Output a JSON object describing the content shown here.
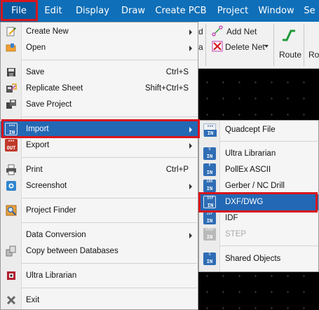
{
  "menubar": {
    "items": [
      "File",
      "Edit",
      "Display",
      "Draw",
      "Create PCB",
      "Project",
      "Window",
      "Se"
    ]
  },
  "toolbar": {
    "add_net": "Add Net",
    "delete_net": "Delete Net",
    "route": "Route",
    "ro": "Ro"
  },
  "file_menu": {
    "create_new": "Create New",
    "open": "Open",
    "save": "Save",
    "save_shortcut": "Ctrl+S",
    "replicate_sheet": "Replicate Sheet",
    "replicate_shortcut": "Shift+Ctrl+S",
    "save_project": "Save Project",
    "import": "Import",
    "export": "Export",
    "print": "Print",
    "print_shortcut": "Ctrl+P",
    "screenshot": "Screenshot",
    "project_finder": "Project Finder",
    "data_conversion": "Data Conversion",
    "copy_between_databases": "Copy between Databases",
    "ultra_librarian": "Ultra Librarian",
    "exit": "Exit"
  },
  "import_menu": {
    "quadcept_file": "Quadcept File",
    "ultra_librarian": "Ultra Librarian",
    "pollex_ascii": "PollEx ASCII",
    "gerber_nc_drill": "Gerber / NC Drill",
    "dxf_dwg": "DXF/DWG",
    "idf": "IDF",
    "step": "STEP",
    "shared_objects": "Shared Objects"
  },
  "icon_text": {
    "in": "IN",
    "out": "OUT",
    "u": "U",
    "p": "P",
    "gbr": "GBR",
    "dxf": "DXF",
    "idf": "IDF",
    "step": "STEP",
    "s": "S"
  },
  "colors": {
    "menubar": "#0f6fb8",
    "highlight": "#2368b4",
    "callout": "#d7161b"
  }
}
